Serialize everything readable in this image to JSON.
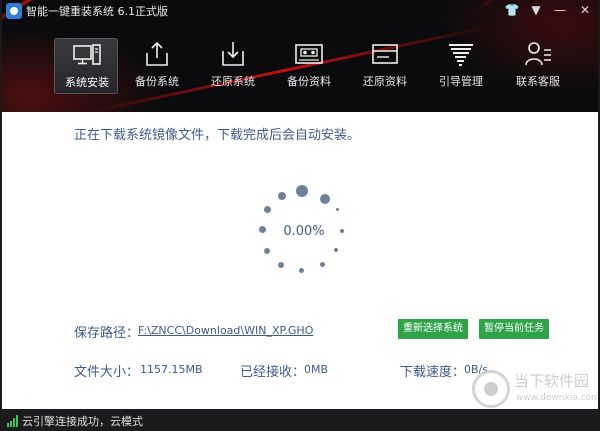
{
  "window": {
    "title": "智能一键重装系统 6.1正式版",
    "controls": {
      "skin": "👕",
      "menu": "▼",
      "minimize": "—",
      "close": "✕"
    }
  },
  "toolbar": {
    "items": [
      {
        "label": "系统安装",
        "icon": "monitor-pc-icon",
        "active": true
      },
      {
        "label": "备份系统",
        "icon": "upload-icon",
        "active": false
      },
      {
        "label": "还原系统",
        "icon": "download-icon",
        "active": false
      },
      {
        "label": "备份资料",
        "icon": "cassette-icon",
        "active": false
      },
      {
        "label": "还原资料",
        "icon": "card-icon",
        "active": false
      },
      {
        "label": "引导管理",
        "icon": "tornado-icon",
        "active": false
      },
      {
        "label": "联系客服",
        "icon": "user-list-icon",
        "active": false
      }
    ]
  },
  "main": {
    "status_message": "正在下载系统镜像文件，下载完成后会自动安装。",
    "progress": "0.00%",
    "save_path_label": "保存路径：",
    "save_path_value": "F:\\ZNCC\\Download\\WIN_XP.GHO",
    "file_size_label": "文件大小：",
    "file_size_value": "1157.15MB",
    "received_label": "已经接收：",
    "received_value": "0MB",
    "speed_label": "下载速度：",
    "speed_value": "0B/s",
    "reselect_button": "重新选择系统",
    "pause_button": "暂停当前任务"
  },
  "statusbar": {
    "text": "云引擎连接成功，云模式"
  },
  "watermark": {
    "name": "当下软件园",
    "url": "www.downxia.com"
  },
  "colors": {
    "header_bg": "#0b0b0d",
    "accent_red": "#e01515",
    "text_blue": "#3e5b8f",
    "button_green": "#2fa34a"
  }
}
